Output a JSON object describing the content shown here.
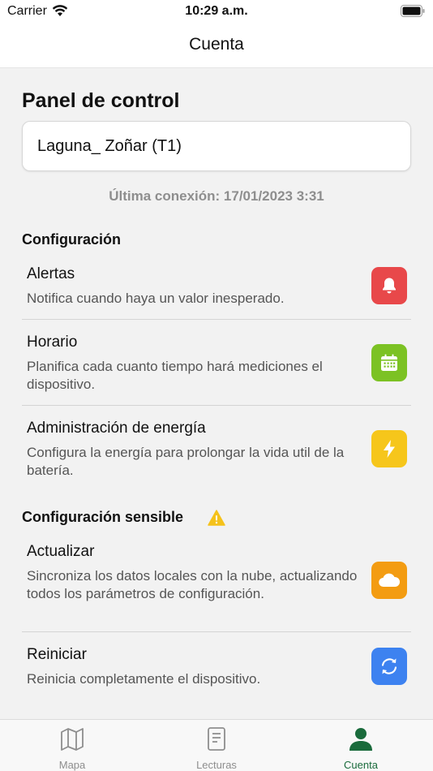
{
  "status_bar": {
    "carrier": "Carrier",
    "time": "10:29 a.m."
  },
  "nav": {
    "title": "Cuenta"
  },
  "panel": {
    "title": "Panel de control",
    "device_name": "Laguna_ Zoñar (T1)",
    "last_connection": "Última conexión: 17/01/2023 3:31"
  },
  "config": {
    "title": "Configuración",
    "items": [
      {
        "title": "Alertas",
        "desc": "Notifica cuando haya un valor inesperado.",
        "icon": "bell-icon",
        "color": "#e8484a"
      },
      {
        "title": "Horario",
        "desc": "Planifica cada cuanto tiempo hará mediciones el dispositivo.",
        "icon": "calendar-icon",
        "color": "#7cc224"
      },
      {
        "title": "Administración de energía",
        "desc": "Configura la energía para prolongar la vida util de la batería.",
        "icon": "lightning-icon",
        "color": "#f6c61b"
      }
    ]
  },
  "sensitive": {
    "title": "Configuración sensible",
    "warning_icon": "warning-icon",
    "warning_color": "#f5c21b",
    "items": [
      {
        "title": "Actualizar",
        "desc": "Sincroniza los datos locales con la nube, actualizando todos los parámetros de configuración.",
        "icon": "cloud-icon",
        "color": "#f39c12"
      },
      {
        "title": "Reiniciar",
        "desc": "Reinicia completamente el dispositivo.",
        "icon": "refresh-icon",
        "color": "#3d82f0"
      }
    ]
  },
  "tabs": [
    {
      "label": "Mapa",
      "icon": "map-icon"
    },
    {
      "label": "Lecturas",
      "icon": "document-icon"
    },
    {
      "label": "Cuenta",
      "icon": "person-icon",
      "active": true,
      "color": "#1a6b3c"
    }
  ]
}
